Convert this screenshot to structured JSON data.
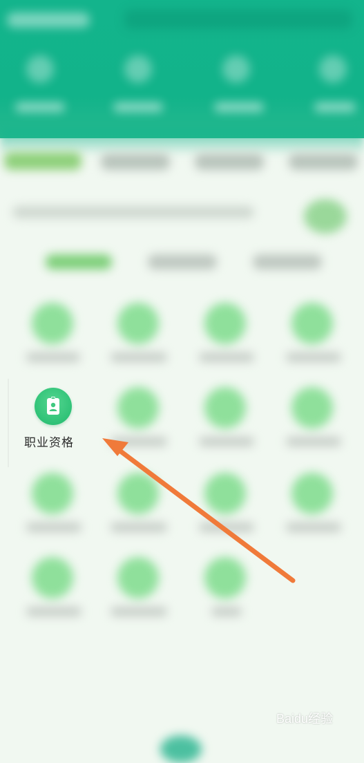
{
  "focused_item": {
    "label": "职业资格",
    "icon": "id-badge-icon"
  },
  "annotation": {
    "arrow_color": "#f07a3a"
  },
  "colors": {
    "header_green": "#13b48c",
    "icon_green": "#2fc277",
    "background": "#f1f8f1"
  },
  "watermark": {
    "text": "Baidu经验"
  }
}
